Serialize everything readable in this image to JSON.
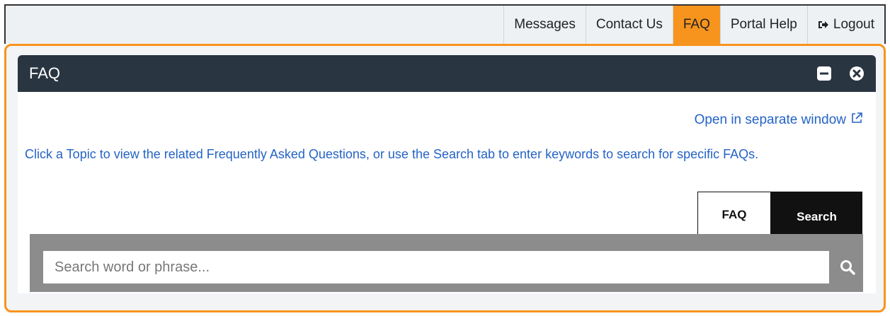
{
  "topnav": {
    "messages": "Messages",
    "contact": "Contact Us",
    "faq": "FAQ",
    "portal_help": "Portal Help",
    "logout": "Logout",
    "active": "FAQ"
  },
  "panel": {
    "title": "FAQ",
    "open_window_label": "Open in separate window",
    "intro_text": "Click a Topic to view the related Frequently Asked Questions, or use the Search tab to enter keywords to search for specific FAQs."
  },
  "tabs": {
    "faq": "FAQ",
    "search": "Search",
    "active": "Search"
  },
  "search": {
    "placeholder": "Search word or phrase...",
    "value": ""
  },
  "icons": {
    "logout": "sign-out-icon",
    "minimize": "minimize-icon",
    "close": "close-icon",
    "external": "external-link-icon",
    "search": "search-icon"
  },
  "colors": {
    "accent": "#f7941d",
    "header_bg": "#2a3542",
    "link": "#2563c6",
    "tab_active": "#111111",
    "search_bar": "#8c8c8c"
  }
}
